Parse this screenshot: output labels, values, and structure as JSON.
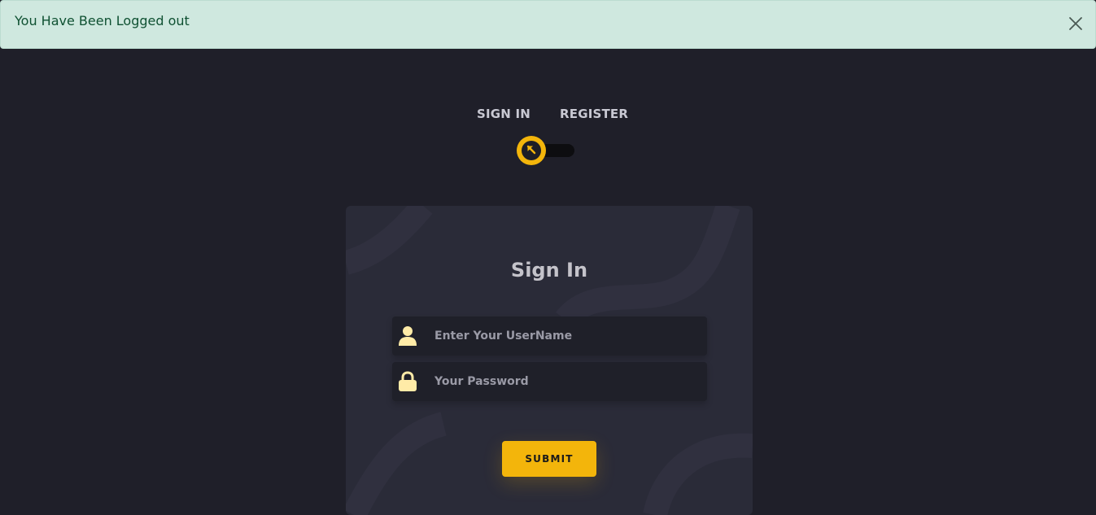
{
  "alert": {
    "message": "You Have Been Logged out",
    "close_icon": "close-icon"
  },
  "auth_tabs": {
    "signin_label": "SIGN IN",
    "register_label": "REGISTER",
    "toggle_state": "sign-in",
    "toggle_icon": "arrow-up-left-icon"
  },
  "form": {
    "title": "Sign In",
    "username": {
      "placeholder": "Enter Your UserName",
      "value": "",
      "icon": "user-icon"
    },
    "password": {
      "placeholder": "Your Password",
      "value": "",
      "icon": "lock-icon"
    },
    "submit_label": "SUBMIT"
  },
  "colors": {
    "background": "#1f1f29",
    "card": "#2a2b38",
    "accent": "#f3b50b",
    "alert_bg": "#cfe8df",
    "alert_text": "#0f5132",
    "icon": "#ffeba7"
  }
}
